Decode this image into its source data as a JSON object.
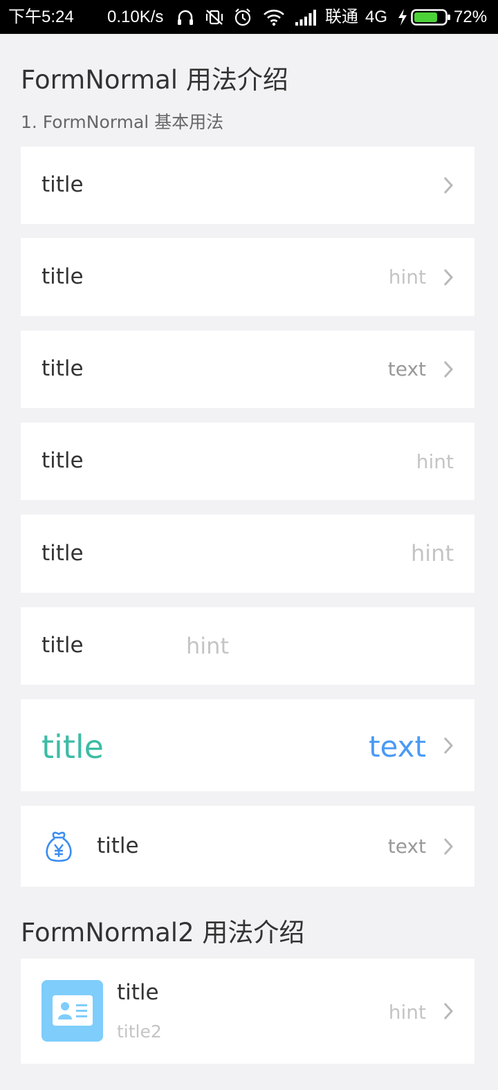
{
  "status_bar": {
    "time": "下午5:24",
    "net_speed": "0.10K/s",
    "carrier": "联通",
    "network": "4G",
    "battery": "72%",
    "battery_color": "#4cd137"
  },
  "section1": {
    "heading": "FormNormal 用法介绍",
    "subheading": "1. FormNormal 基本用法",
    "rows": [
      {
        "title": "title"
      },
      {
        "title": "title",
        "hint": "hint"
      },
      {
        "title": "title",
        "text": "text"
      },
      {
        "title": "title",
        "hint": "hint"
      },
      {
        "title": "title",
        "hint": "hint"
      },
      {
        "title": "title",
        "hint": "hint"
      },
      {
        "title": "title",
        "text": "text",
        "title_color": "#3dbca5",
        "text_color": "#4a9af5"
      },
      {
        "icon": "money-bag-icon",
        "title": "title",
        "text": "text",
        "icon_color": "#3a8ef0"
      }
    ]
  },
  "section2": {
    "heading": "FormNormal2 用法介绍",
    "rows": [
      {
        "icon": "id-card-icon",
        "icon_bg": "#7ecdfb",
        "title": "title",
        "subtitle": "title2",
        "hint": "hint"
      }
    ]
  }
}
